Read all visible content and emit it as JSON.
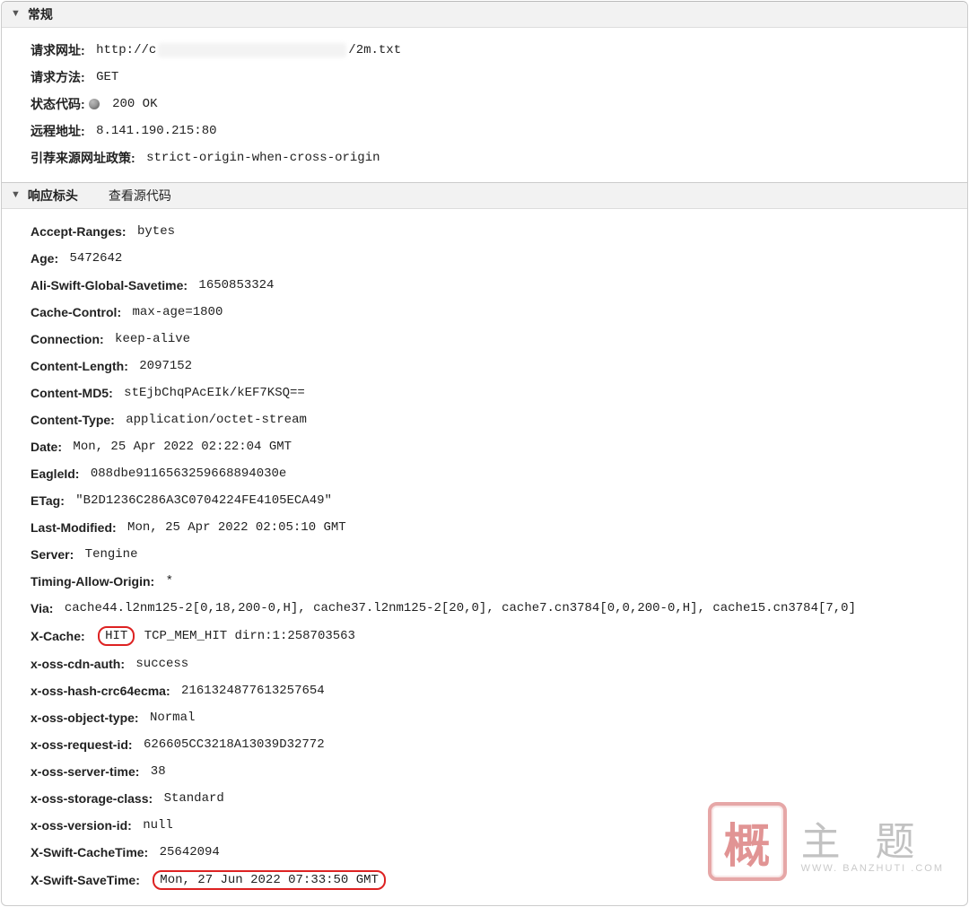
{
  "sections": {
    "general": {
      "title": "常规",
      "rows": [
        {
          "label": "请求网址:",
          "prefix": "http://c",
          "suffix": "/2m.txt",
          "blur": true
        },
        {
          "label": "请求方法:",
          "value": "GET"
        },
        {
          "label": "状态代码:",
          "value": "200 OK",
          "statusDot": true
        },
        {
          "label": "远程地址:",
          "value": "8.141.190.215:80"
        },
        {
          "label": "引荐来源网址政策:",
          "value": "strict-origin-when-cross-origin"
        }
      ]
    },
    "response": {
      "title": "响应标头",
      "viewSourceLabel": "查看源代码",
      "headers": [
        {
          "name": "Accept-Ranges:",
          "value": "bytes"
        },
        {
          "name": "Age:",
          "value": "5472642"
        },
        {
          "name": "Ali-Swift-Global-Savetime:",
          "value": "1650853324"
        },
        {
          "name": "Cache-Control:",
          "value": "max-age=1800"
        },
        {
          "name": "Connection:",
          "value": "keep-alive"
        },
        {
          "name": "Content-Length:",
          "value": "2097152"
        },
        {
          "name": "Content-MD5:",
          "value": "stEjbChqPAcEIk/kEF7KSQ=="
        },
        {
          "name": "Content-Type:",
          "value": "application/octet-stream"
        },
        {
          "name": "Date:",
          "value": "Mon, 25 Apr 2022 02:22:04 GMT"
        },
        {
          "name": "EagleId:",
          "value": "088dbe9116563259668894030e"
        },
        {
          "name": "ETag:",
          "value": "\"B2D1236C286A3C0704224FE4105ECA49\""
        },
        {
          "name": "Last-Modified:",
          "value": "Mon, 25 Apr 2022 02:05:10 GMT"
        },
        {
          "name": "Server:",
          "value": "Tengine"
        },
        {
          "name": "Timing-Allow-Origin:",
          "value": "*"
        },
        {
          "name": "Via:",
          "value": "cache44.l2nm125-2[0,18,200-0,H], cache37.l2nm125-2[20,0], cache7.cn3784[0,0,200-0,H], cache15.cn3784[7,0]"
        },
        {
          "name": "X-Cache:",
          "valueParts": [
            {
              "text": "HIT",
              "circled": true
            },
            {
              "text": " TCP_MEM_HIT dirn:1:258703563"
            }
          ]
        },
        {
          "name": "x-oss-cdn-auth:",
          "value": "success"
        },
        {
          "name": "x-oss-hash-crc64ecma:",
          "value": "2161324877613257654"
        },
        {
          "name": "x-oss-object-type:",
          "value": "Normal"
        },
        {
          "name": "x-oss-request-id:",
          "value": "626605CC3218A13039D32772"
        },
        {
          "name": "x-oss-server-time:",
          "value": "38"
        },
        {
          "name": "x-oss-storage-class:",
          "value": "Standard"
        },
        {
          "name": "x-oss-version-id:",
          "value": "null"
        },
        {
          "name": "X-Swift-CacheTime:",
          "value": "25642094"
        },
        {
          "name": "X-Swift-SaveTime:",
          "valueParts": [
            {
              "text": "Mon, 27 Jun 2022 07:33:50 GMT",
              "circled": true
            }
          ]
        }
      ]
    }
  },
  "watermark": {
    "seal": "概",
    "text": "主 题",
    "sub": "WWW. BANZHUTI .COM"
  }
}
